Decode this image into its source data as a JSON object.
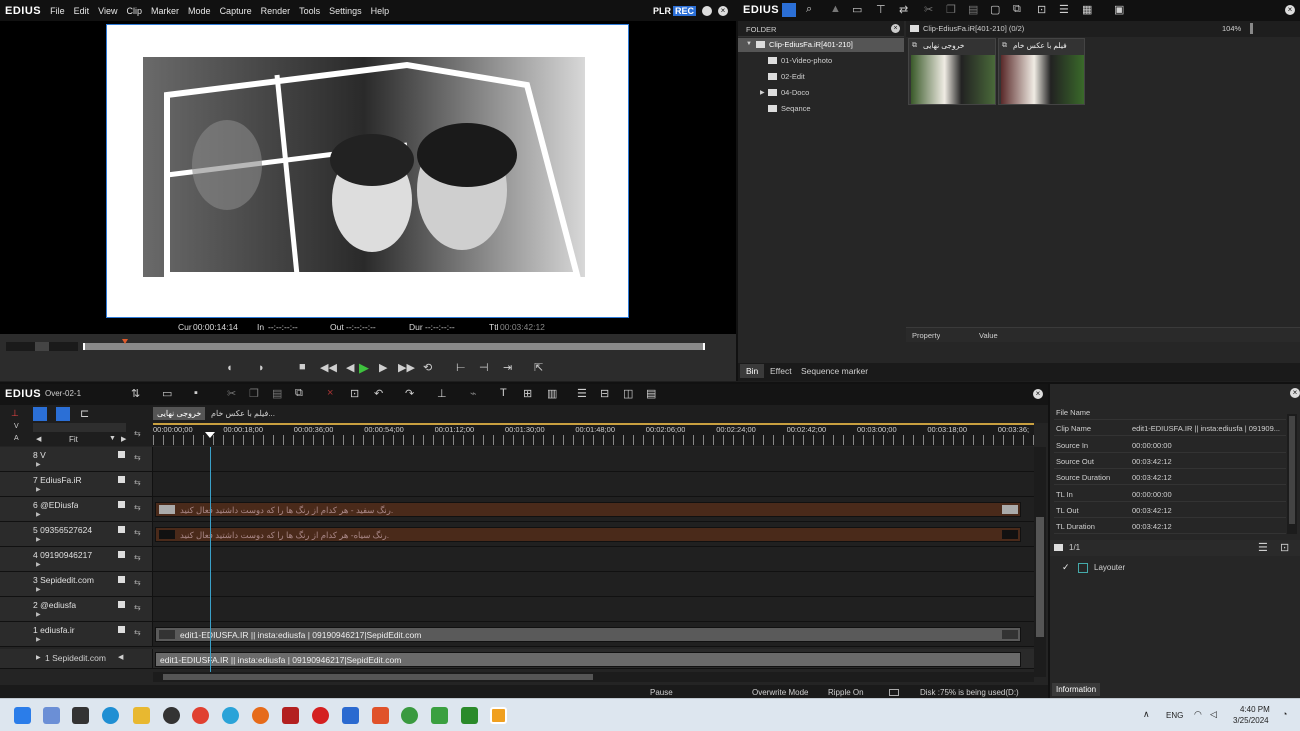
{
  "menubar": {
    "logo": "EDIUS",
    "items": [
      "File",
      "Edit",
      "View",
      "Clip",
      "Marker",
      "Mode",
      "Capture",
      "Render",
      "Tools",
      "Settings",
      "Help"
    ],
    "plr": "PLR",
    "rec": "REC"
  },
  "timecode": {
    "cur_label": "Cur",
    "cur": "00:00:14:14",
    "in_label": "In",
    "in": "--:--:--:--",
    "out_label": "Out",
    "out": "--:--:--:--",
    "dur_label": "Dur",
    "dur": "--:--:--:--",
    "ttl_label": "Ttl",
    "ttl": "00:03:42:12",
    "progress": 0.06
  },
  "bin": {
    "logo": "EDIUS",
    "folder_label": "FOLDER",
    "root": "Clip-EdiusFa.iR[401-210]",
    "folders": [
      "01-Video-photo",
      "02-Edit",
      "04-Doco",
      "Seqance"
    ],
    "path": "Clip-EdiusFa.iR[401-210] (0/2)",
    "zoom": "104%",
    "clips": [
      "خروجی نهایی",
      "فیلم با عکس خام"
    ],
    "property_col": "Property",
    "value_col": "Value",
    "tabs": [
      "Bin",
      "Effect",
      "Sequence marker"
    ]
  },
  "timeline": {
    "logo": "EDIUS",
    "sequence": "Over-02-1",
    "tabs": [
      "خروجی نهایی",
      "فیلم با عکس خام..."
    ],
    "v_label": "V",
    "a_label": "A",
    "fit": "Fit",
    "ruler": [
      "00:00:00;00",
      "00:00:18;00",
      "00:00:36;00",
      "00:00:54;00",
      "00:01:12;00",
      "00:01:30;00",
      "00:01:48;00",
      "00:02:06;00",
      "00:02:24;00",
      "00:02:42;00",
      "00:03:00;00",
      "00:03:18;00",
      "00:03:36;"
    ],
    "tracks": [
      "8 V",
      "7 EdiusFa.iR",
      "6 @EDiusfa",
      "5 09356527624",
      "4 09190946217",
      "3 Sepidedit.com",
      "2 @ediusfa",
      "1 ediusfa.ir"
    ],
    "clip6": "رنگ سفید - هر کدام از رنگ ها را که دوست داشتید فعال کنید.",
    "clip5": "رنگ  سیاه- هر کدام از رنگ ها را که دوست داشتید فعال کنید.",
    "clip1": "edit1-EDIUSFA.IR || insta:ediusfa |  09190946217|SepidEdit.com",
    "audio_track": "1 Sepidedit.com",
    "audio_clip": "edit1-EDIUSFA.IR || insta:ediusfa |  09190946217|SepidEdit.com"
  },
  "status": {
    "pause": "Pause",
    "overwrite": "Overwrite Mode",
    "ripple": "Ripple On",
    "disk": "Disk :75% is being used(D:)"
  },
  "info": {
    "rows": [
      [
        "File Name",
        ""
      ],
      [
        "Clip Name",
        "edit1-EDIUSFA.IR || insta:ediusfa |  091909..."
      ],
      [
        "Source In",
        "00:00:00:00"
      ],
      [
        "Source Out",
        "00:03:42:12"
      ],
      [
        "Source Duration",
        "00:03:42:12"
      ],
      [
        "TL In",
        "00:00:00:00"
      ],
      [
        "TL Out",
        "00:03:42:12"
      ],
      [
        "TL Duration",
        "00:03:42:12"
      ]
    ],
    "page": "1/1",
    "layouter": "Layouter",
    "tab": "Information"
  },
  "taskbar": {
    "lang": "ENG",
    "time": "4:40 PM",
    "date": "3/25/2024"
  }
}
